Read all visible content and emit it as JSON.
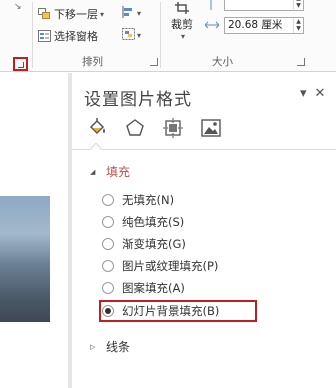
{
  "ribbon": {
    "send_backward_label": "下移一层",
    "selection_pane_label": "选择窗格",
    "arrange_group_label": "排列",
    "crop_label": "裁剪",
    "size_group_label": "大小",
    "width_value": "20.68 厘米",
    "height_value": "",
    "spin_up": "▲",
    "spin_down": "▼",
    "caret": "▾"
  },
  "pane": {
    "title": "设置图片格式",
    "pin_icon": "▾",
    "close_icon": "✕",
    "tabs": [
      "fill-line-icon",
      "effects-icon",
      "size-properties-icon",
      "picture-icon"
    ],
    "fill_section": {
      "label": "填充",
      "options": [
        "无填充(N)",
        "纯色填充(S)",
        "渐变填充(G)",
        "图片或纹理填充(P)",
        "图案填充(A)",
        "幻灯片背景填充(B)"
      ],
      "selected_index": 5
    },
    "line_section": {
      "label": "线条"
    }
  },
  "colors": {
    "accent_red": "#c21e22",
    "section_heading": "#c0504d"
  }
}
